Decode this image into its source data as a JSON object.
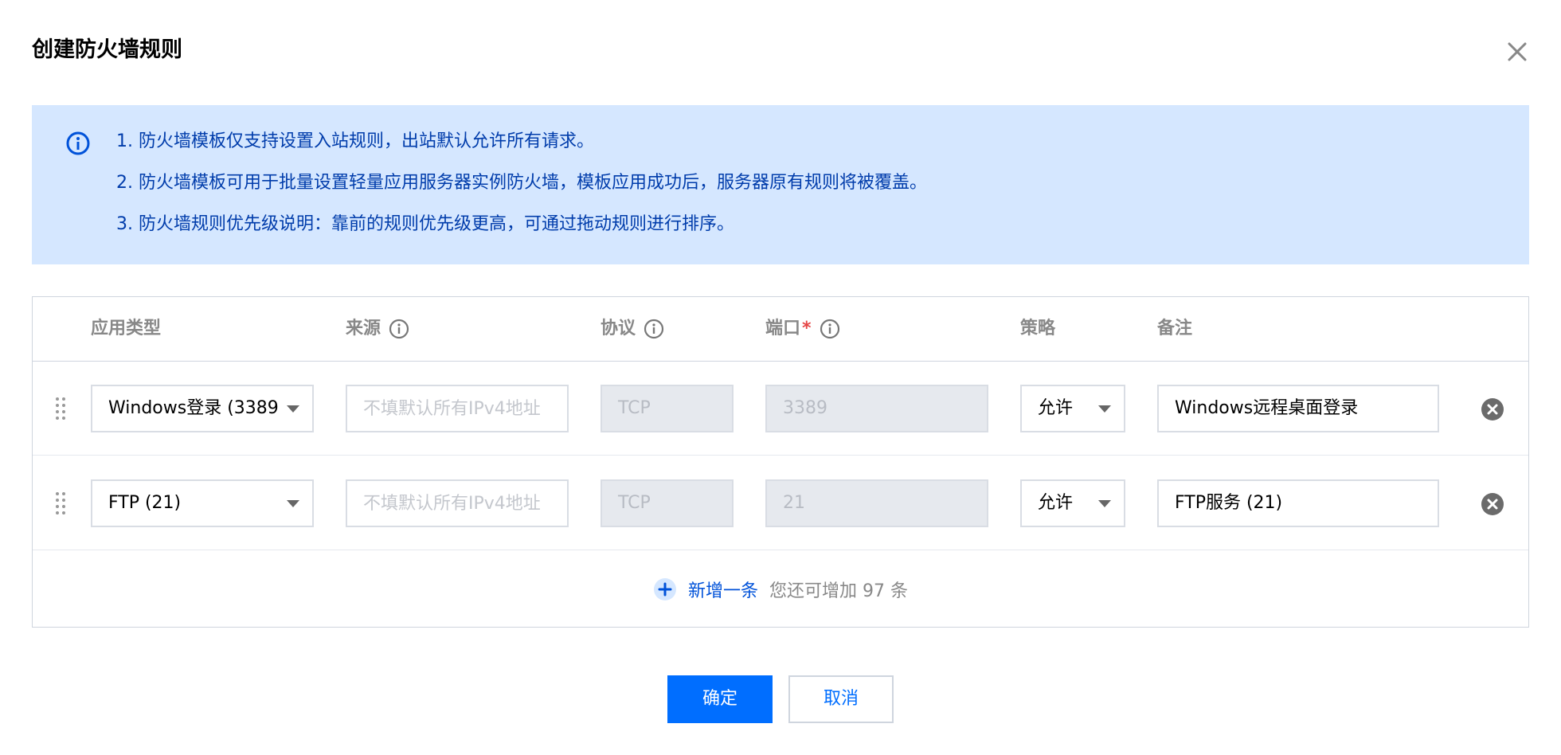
{
  "dialog": {
    "title": "创建防火墙规则"
  },
  "notice": {
    "lines": [
      "1. 防火墙模板仅支持设置入站规则，出站默认允许所有请求。",
      "2. 防火墙模板可用于批量设置轻量应用服务器实例防火墙，模板应用成功后，服务器原有规则将被覆盖。",
      "3. 防火墙规则优先级说明：靠前的规则优先级更高，可通过拖动规则进行排序。"
    ]
  },
  "table": {
    "headers": {
      "app_type": "应用类型",
      "source": "来源",
      "protocol": "协议",
      "port": "端口",
      "port_required": "*",
      "policy": "策略",
      "remark": "备注"
    },
    "rows": [
      {
        "app_type": "Windows登录 (3389",
        "source_placeholder": "不填默认所有IPv4地址",
        "protocol": "TCP",
        "port": "3389",
        "policy": "允许",
        "remark": "Windows远程桌面登录"
      },
      {
        "app_type": "FTP (21)",
        "source_placeholder": "不填默认所有IPv4地址",
        "protocol": "TCP",
        "port": "21",
        "policy": "允许",
        "remark": "FTP服务 (21)"
      }
    ],
    "add": {
      "label": "新增一条",
      "hint": "您还可增加 97 条"
    }
  },
  "footer": {
    "confirm_label": "确定",
    "cancel_label": "取消"
  },
  "colors": {
    "primary": "#006eff",
    "notice_bg": "#d5e7ff",
    "notice_text": "#003cab",
    "required": "#e54545"
  },
  "icons": [
    "close-icon",
    "info-circle-icon",
    "drag-handle-icon",
    "caret-down-icon",
    "remove-circle-icon",
    "plus-circle-icon"
  ]
}
